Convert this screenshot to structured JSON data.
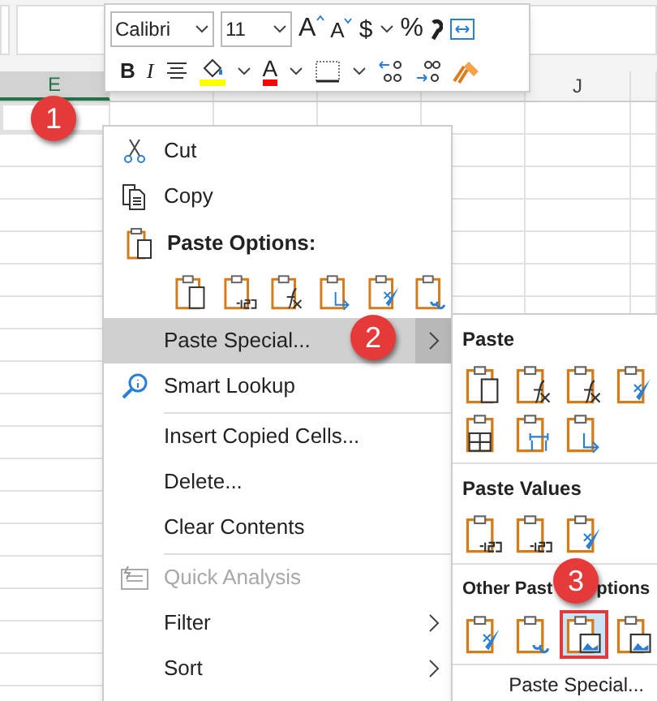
{
  "columns": [
    {
      "letter": "E",
      "selected": true
    },
    {
      "letter": "J",
      "selected": false
    }
  ],
  "toolbar": {
    "font_name": "Calibri",
    "font_size": "11",
    "grow_font": "A",
    "shrink_font": "A",
    "currency": "$",
    "percent": "%",
    "bold": "B",
    "italic": "I",
    "font_color": "A"
  },
  "context_menu": {
    "items": [
      {
        "kind": "item",
        "label": "Cut",
        "disabled": false,
        "submenu": false,
        "selected": false
      },
      {
        "kind": "item",
        "label": "Copy",
        "disabled": false,
        "submenu": false,
        "selected": false
      },
      {
        "kind": "header",
        "label": "Paste Options:"
      },
      {
        "kind": "icons"
      },
      {
        "kind": "item",
        "label": "Paste Special...",
        "disabled": false,
        "submenu": true,
        "selected": true
      },
      {
        "kind": "item",
        "label": "Smart Lookup",
        "disabled": false,
        "submenu": false,
        "selected": false
      },
      {
        "kind": "item",
        "label": "Insert Copied Cells...",
        "disabled": false,
        "submenu": false,
        "selected": false
      },
      {
        "kind": "item",
        "label": "Delete...",
        "disabled": false,
        "submenu": false,
        "selected": false
      },
      {
        "kind": "item",
        "label": "Clear Contents",
        "disabled": false,
        "submenu": false,
        "selected": false
      },
      {
        "kind": "item",
        "label": "Quick Analysis",
        "disabled": true,
        "submenu": false,
        "selected": false
      },
      {
        "kind": "item",
        "label": "Filter",
        "disabled": false,
        "submenu": true,
        "selected": false
      },
      {
        "kind": "item",
        "label": "Sort",
        "disabled": false,
        "submenu": true,
        "selected": false
      }
    ]
  },
  "submenu": {
    "sections": [
      {
        "title": "Paste",
        "icons": [
          {
            "selected": false
          },
          {
            "selected": false
          },
          {
            "selected": false
          },
          {
            "selected": false
          },
          {
            "selected": false
          },
          {
            "selected": false
          },
          {
            "selected": false
          }
        ]
      },
      {
        "title": "Paste Values",
        "icons": [
          {
            "selected": false
          },
          {
            "selected": false
          },
          {
            "selected": false
          }
        ]
      },
      {
        "title_parts": [
          "Other Past",
          "ptions"
        ],
        "icons": [
          {
            "selected": false
          },
          {
            "selected": false
          },
          {
            "selected": true
          },
          {
            "selected": false
          }
        ]
      }
    ],
    "footer": "Paste Special..."
  },
  "callouts": [
    "1",
    "2",
    "3"
  ]
}
